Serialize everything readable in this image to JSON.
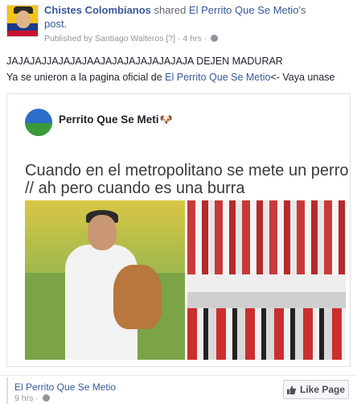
{
  "header": {
    "page_name": "Chistes Colombianos",
    "shared_word": "shared",
    "source_page": "El Perrito Que Se Metio",
    "source_suffix": "'s",
    "post_word": "post.",
    "published_by": "Published by Santiago Walteros",
    "published_by_marker": "[?]",
    "separator": "·",
    "time": "4 hrs",
    "separator2": "·"
  },
  "post": {
    "line1": "JAJAJAJJAJAJAJAAJAJAJAJAJAJAJAJA DEJEN MADURAR",
    "line2_prefix": "Ya se unieron a la pagina oficial de ",
    "line2_link": "El Perrito Que Se Metio",
    "line2_suffix": "<- Vaya unase"
  },
  "shared_card": {
    "page_name": "Perrito Que Se Meti",
    "emoji": "🐶",
    "meme_line1": "Cuando en el metropolitano se mete un perro",
    "meme_line2": "// ah pero cuando es una burra"
  },
  "footer": {
    "page_name": "El Perrito Que Se Metio",
    "time": "9 hrs",
    "separator": "·",
    "like_label": "Like Page"
  },
  "colors": {
    "link": "#365899",
    "muted": "#90949c",
    "text": "#1d2129"
  }
}
